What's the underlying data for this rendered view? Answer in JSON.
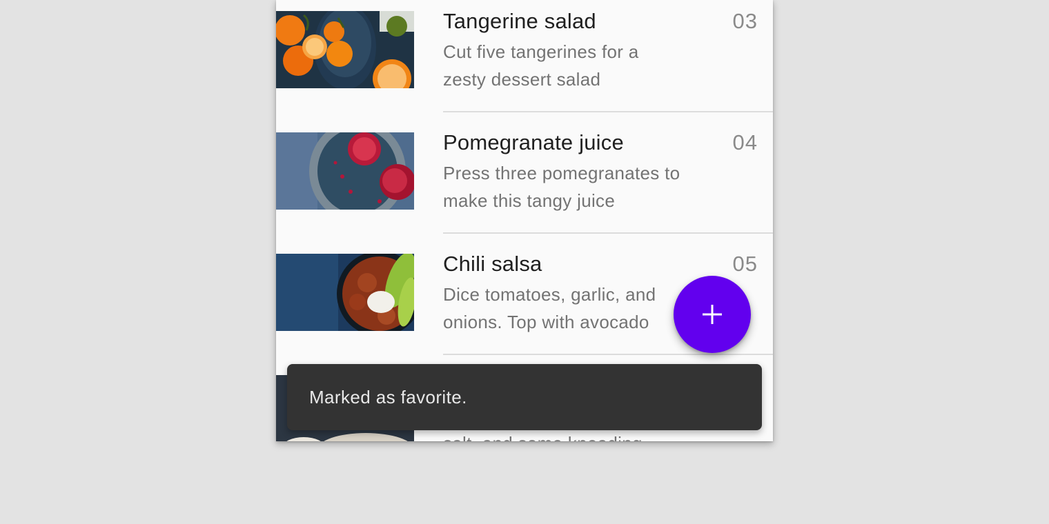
{
  "recipes": [
    {
      "title": "Tangerine salad",
      "desc_line1": "Cut five tangerines for a",
      "desc_line2": "zesty dessert salad",
      "number": "03",
      "image": "tangerines-photo"
    },
    {
      "title": "Pomegranate juice",
      "desc_line1": "Press three pomegranates to",
      "desc_line2": "make this tangy juice",
      "number": "04",
      "image": "pomegranate-photo"
    },
    {
      "title": "Chili salsa",
      "desc_line1": "Dice tomatoes, garlic, and",
      "desc_line2": "onions. Top with avocado",
      "number": "05",
      "image": "chili-salsa-photo"
    },
    {
      "desc_line2": "salt, and some kneading",
      "image": "dough-photo"
    }
  ],
  "fab": {
    "icon": "plus-icon",
    "color": "#6200ee"
  },
  "snackbar": {
    "message": "Marked as favorite."
  },
  "colors": {
    "background": "#e3e3e3",
    "surface": "#fafafa",
    "snackbar": "#333333"
  }
}
